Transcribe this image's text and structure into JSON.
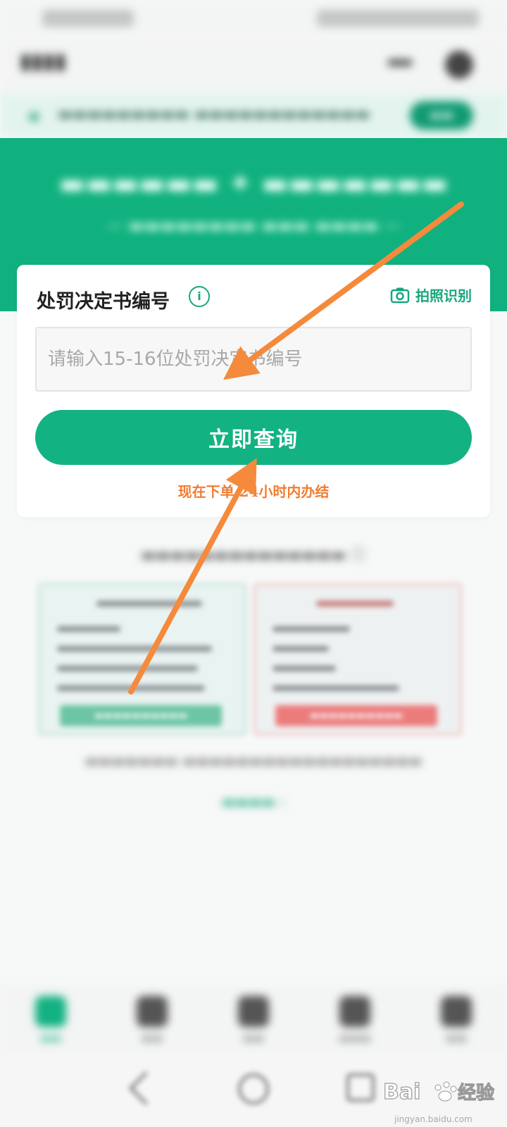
{
  "query_card": {
    "field_label": "处罚决定书编号",
    "photo_label": "拍照识别",
    "input_placeholder": "请输入15-16位处罚决定书编号",
    "input_value": "",
    "query_button": "立即查询",
    "promo_text": "现在下单 24小时内办结"
  },
  "colors": {
    "brand_green": "#12b282",
    "promo_orange": "#f07d32",
    "annotation_arrow": "#f58a3c"
  },
  "icons": {
    "info": "info-icon",
    "camera": "camera-icon"
  }
}
